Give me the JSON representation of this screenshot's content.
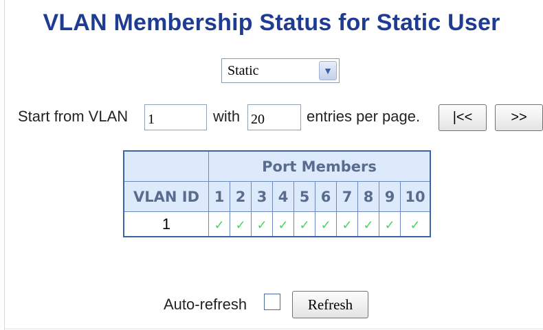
{
  "page": {
    "title": "VLAN Membership Status for Static User"
  },
  "filter": {
    "selected": "Static"
  },
  "paging": {
    "start_label": "Start from VLAN",
    "start_value": "1",
    "with_label": "with",
    "entries_value": "20",
    "entries_label": "entries per page.",
    "first_label": "|<<",
    "next_label": ">>"
  },
  "table": {
    "group_header": "Port Members",
    "vlan_header": "VLAN ID",
    "port_columns": [
      "1",
      "2",
      "3",
      "4",
      "5",
      "6",
      "7",
      "8",
      "9",
      "10"
    ],
    "rows": [
      {
        "vlan_id": "1",
        "members": [
          true,
          true,
          true,
          true,
          true,
          true,
          true,
          true,
          true,
          true
        ]
      }
    ]
  },
  "footer": {
    "auto_refresh_label": "Auto-refresh",
    "auto_refresh_checked": false,
    "refresh_label": "Refresh"
  },
  "icons": {
    "member_icon": "check-icon",
    "dropdown_icon": "chevron-down-icon"
  },
  "colors": {
    "title": "#1f3c93",
    "header_bg": "#ddeafb",
    "check": "#4fd45a",
    "table_border": "#3a62a7"
  }
}
